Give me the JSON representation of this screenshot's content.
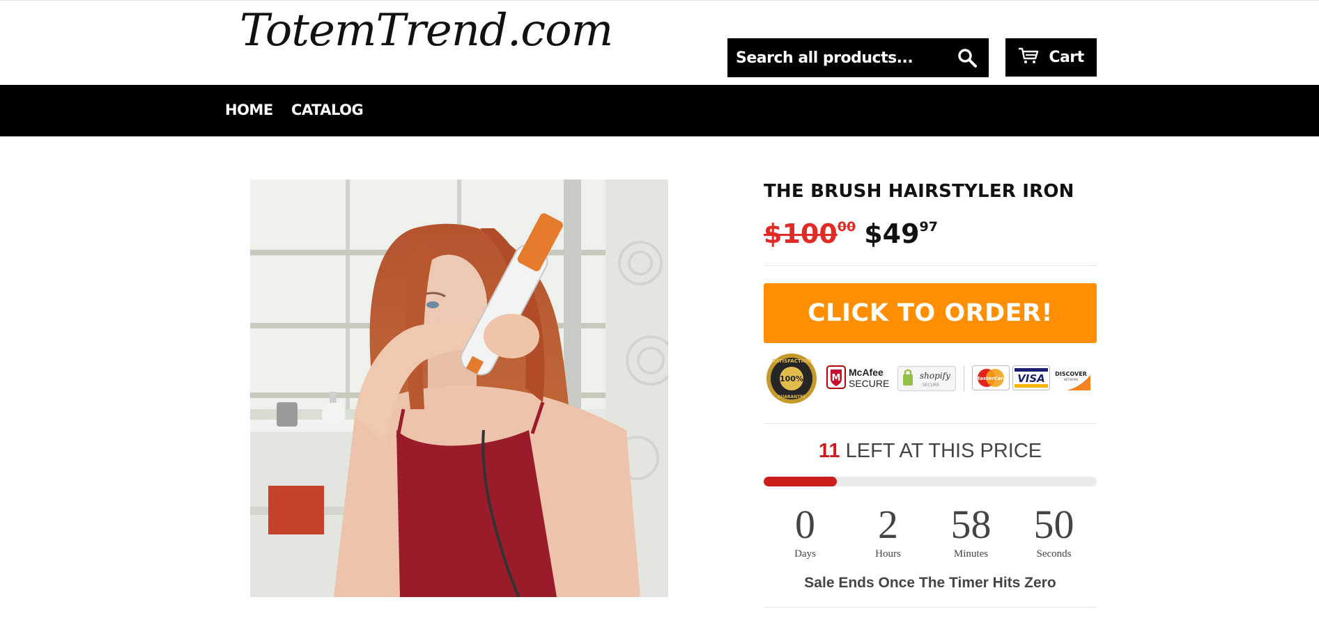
{
  "site": {
    "logo_text": "TotemTrend.com"
  },
  "header": {
    "search_placeholder": "Search all products...",
    "cart_label": "Cart"
  },
  "nav": {
    "items": [
      {
        "label": "HOME"
      },
      {
        "label": "CATALOG"
      }
    ]
  },
  "product": {
    "title": "THE BRUSH HAIRSTYLER IRON",
    "old_price": "$100",
    "old_price_cents": "00",
    "price": "$49",
    "price_cents": "97",
    "order_button_label": "CLICK TO ORDER!"
  },
  "trust_badges": {
    "satisfaction": "100%",
    "satisfaction_ring": "SATISFACTION",
    "satisfaction_guarantee": "GUARANTEE",
    "mcafee_brand": "McAfee",
    "mcafee_secure": "SECURE",
    "shopify_brand": "shopify",
    "shopify_secure": "SECURE",
    "mastercard": "MasterCard",
    "visa": "VISA",
    "discover": "DISCOVER",
    "discover_sub": "NETWORK"
  },
  "scarcity": {
    "count": "11",
    "label": " LEFT AT THIS PRICE",
    "progress_fraction": 0.22
  },
  "countdown": {
    "days": "0",
    "days_label": "Days",
    "hours": "2",
    "hours_label": "Hours",
    "minutes": "58",
    "minutes_label": "Minutes",
    "seconds": "50",
    "seconds_label": "Seconds",
    "footer": "Sale Ends Once The Timer Hits Zero"
  },
  "colors": {
    "accent_orange": "#ff8f00",
    "sale_red": "#e02b27",
    "progress_red": "#cc1d1d",
    "nav_black": "#000000"
  }
}
